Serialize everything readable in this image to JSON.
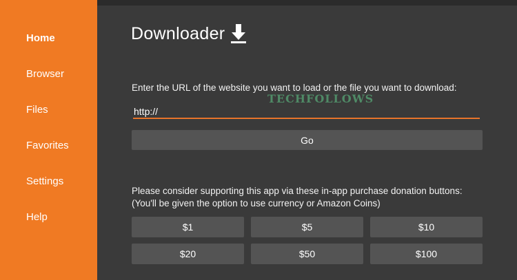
{
  "sidebar": {
    "items": [
      {
        "label": "Home"
      },
      {
        "label": "Browser"
      },
      {
        "label": "Files"
      },
      {
        "label": "Favorites"
      },
      {
        "label": "Settings"
      },
      {
        "label": "Help"
      }
    ]
  },
  "main": {
    "title": "Downloader",
    "title_icon": "download-arrow-icon",
    "prompt": "Enter the URL of the website you want to load or the file you want to download:",
    "watermark": "TECHFOLLOWS",
    "url_value": "http://",
    "go_label": "Go",
    "donate_line1": "Please consider supporting this app via these in-app purchase donation buttons:",
    "donate_line2": "(You'll be given the option to use currency or Amazon Coins)",
    "donations": [
      "$1",
      "$5",
      "$10",
      "$20",
      "$50",
      "$100"
    ]
  },
  "colors": {
    "sidebar": "#f07a23",
    "background": "#3a3a3a",
    "button": "#545454",
    "input_underline": "#e8742a",
    "watermark": "#4f8a66"
  }
}
